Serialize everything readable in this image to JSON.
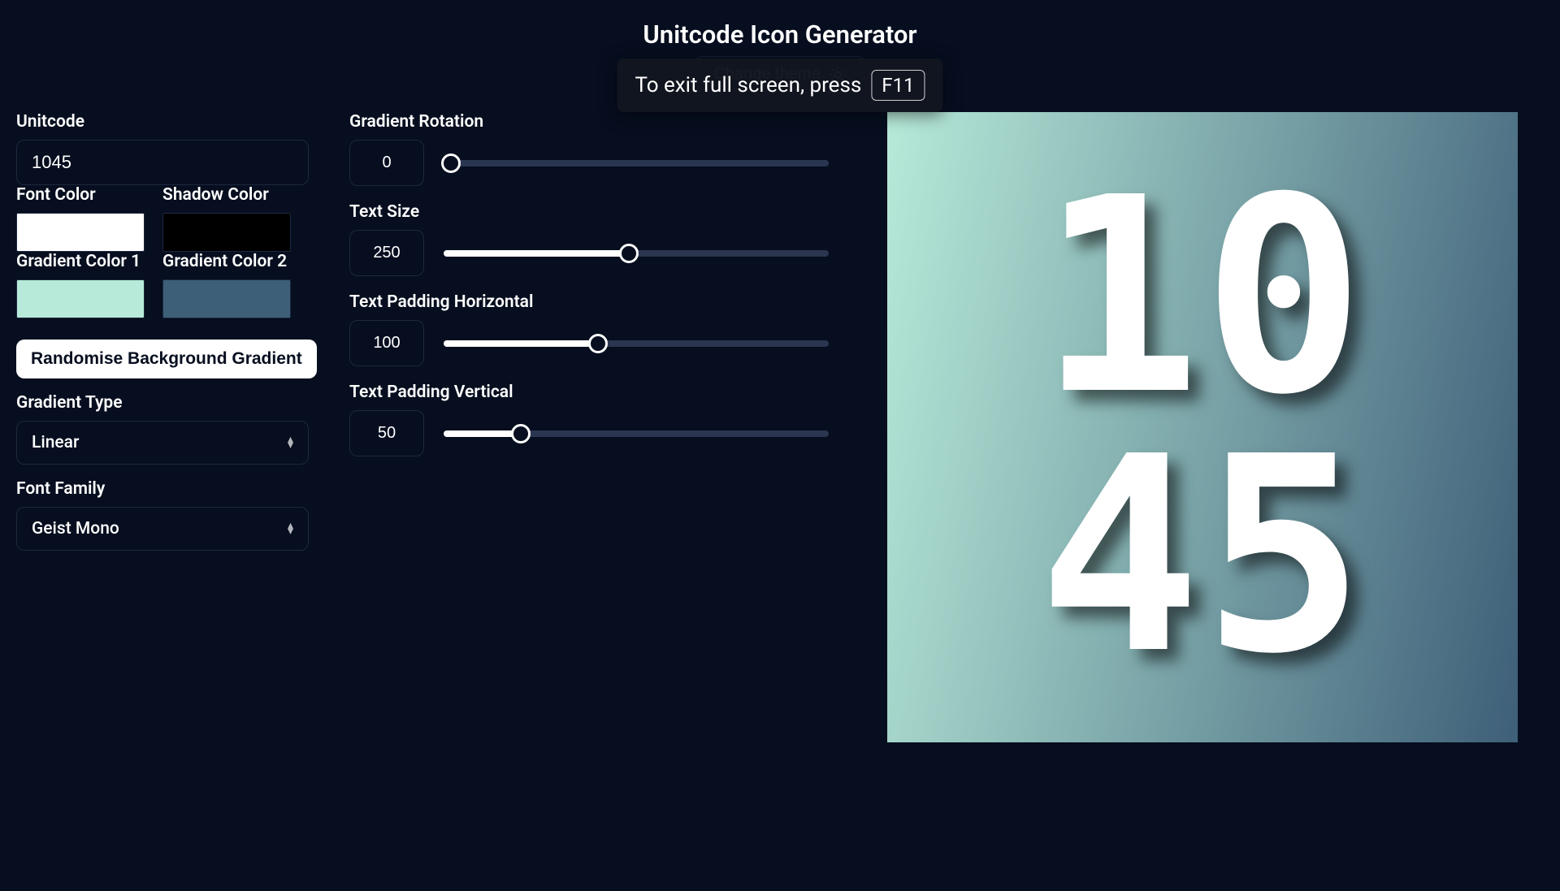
{
  "title": "Unitcode Icon Generator",
  "theme_button_label": "Change theme",
  "overlay": {
    "text": "To exit full screen, press",
    "key": "F11"
  },
  "left": {
    "unitcode_label": "Unitcode",
    "unitcode_value": "1045",
    "font_color_label": "Font Color",
    "font_color_value": "#ffffff",
    "shadow_color_label": "Shadow Color",
    "shadow_color_value": "#000000",
    "grad1_label": "Gradient Color 1",
    "grad1_value": "#b7ead9",
    "grad2_label": "Gradient Color 2",
    "grad2_value": "#3e5f78",
    "randomise_label": "Randomise Background Gradient",
    "gradtype_label": "Gradient Type",
    "gradtype_value": "Linear",
    "fontfamily_label": "Font Family",
    "fontfamily_value": "Geist Mono"
  },
  "mid": {
    "rotation_label": "Gradient Rotation",
    "rotation_value": "0",
    "rotation_pct": 2,
    "textsize_label": "Text Size",
    "textsize_value": "250",
    "textsize_pct": 48,
    "padH_label": "Text Padding Horizontal",
    "padH_value": "100",
    "padH_pct": 40,
    "padV_label": "Text Padding Vertical",
    "padV_value": "50",
    "padV_pct": 20
  },
  "preview": {
    "gradient_from": "#b7ead9",
    "gradient_to": "#3e5f78",
    "gradient_angle": 100,
    "line1": "10",
    "line2": "45",
    "font_size": 332
  }
}
